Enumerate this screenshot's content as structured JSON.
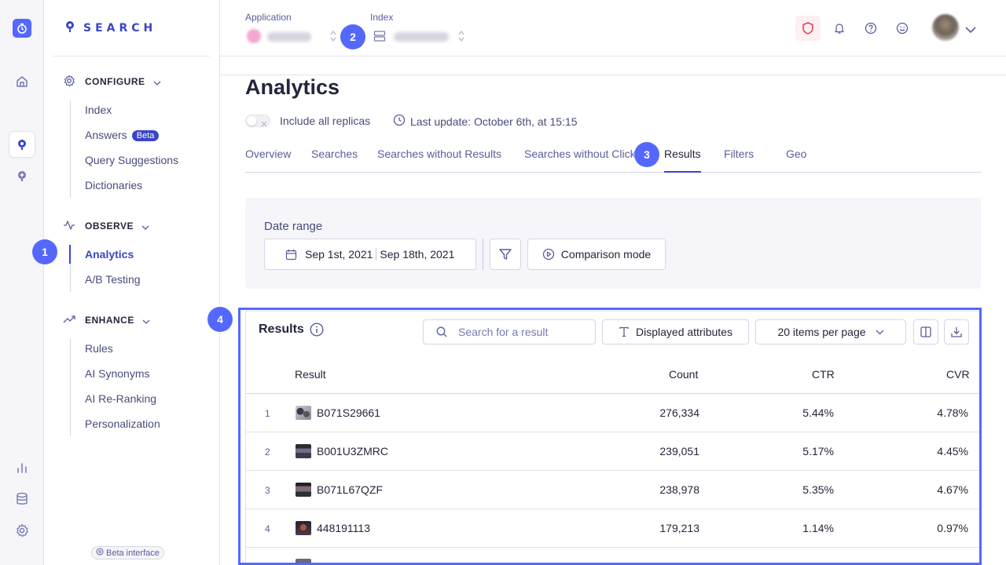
{
  "brand": {
    "name": "SEARCH",
    "accent": "#3a46c7",
    "callout_color": "#5468ff"
  },
  "rail": {
    "icons": [
      "app-logo-icon",
      "home-icon",
      "search-product-icon",
      "recommend-icon",
      "analytics-icon",
      "data-sources-icon",
      "settings-icon"
    ]
  },
  "sidenav": {
    "groups": [
      {
        "title": "CONFIGURE",
        "items": [
          {
            "label": "Index"
          },
          {
            "label": "Answers",
            "badge": "Beta"
          },
          {
            "label": "Query Suggestions"
          },
          {
            "label": "Dictionaries"
          }
        ]
      },
      {
        "title": "OBSERVE",
        "items": [
          {
            "label": "Analytics",
            "active": true
          },
          {
            "label": "A/B Testing"
          }
        ]
      },
      {
        "title": "ENHANCE",
        "items": [
          {
            "label": "Rules"
          },
          {
            "label": "AI Synonyms"
          },
          {
            "label": "AI Re-Ranking"
          },
          {
            "label": "Personalization"
          }
        ]
      }
    ],
    "footer": "Beta interface"
  },
  "header": {
    "application_label": "Application",
    "index_label": "Index"
  },
  "main": {
    "title": "Analytics",
    "replicas_label": "Include all replicas",
    "last_update": "Last update: October 6th, at 15:15",
    "tabs": [
      {
        "label": "Overview"
      },
      {
        "label": "Searches"
      },
      {
        "label": "Searches without Results"
      },
      {
        "label": "Searches without Clicks"
      },
      {
        "label": "Results",
        "active": true
      },
      {
        "label": "Filters"
      },
      {
        "label": "Geo"
      }
    ],
    "date_range": {
      "label": "Date range",
      "start": "Sep 1st, 2021",
      "end": "Sep 18th, 2021",
      "comparison_label": "Comparison mode"
    },
    "results": {
      "title": "Results",
      "search_placeholder": "Search for a result",
      "attributes_label": "Displayed attributes",
      "per_page_label": "20 items per page",
      "columns": [
        "Result",
        "Count",
        "CTR",
        "CVR"
      ],
      "rows": [
        {
          "idx": "1",
          "name": "B071S29661",
          "count": "276,334",
          "ctr": "5.44%",
          "cvr": "4.78%"
        },
        {
          "idx": "2",
          "name": "B001U3ZMRC",
          "count": "239,051",
          "ctr": "5.17%",
          "cvr": "4.45%"
        },
        {
          "idx": "3",
          "name": "B071L67QZF",
          "count": "238,978",
          "ctr": "5.35%",
          "cvr": "4.67%"
        },
        {
          "idx": "4",
          "name": "448191113",
          "count": "179,213",
          "ctr": "1.14%",
          "cvr": "0.97%"
        }
      ]
    }
  },
  "callouts": [
    "1",
    "2",
    "3",
    "4"
  ]
}
